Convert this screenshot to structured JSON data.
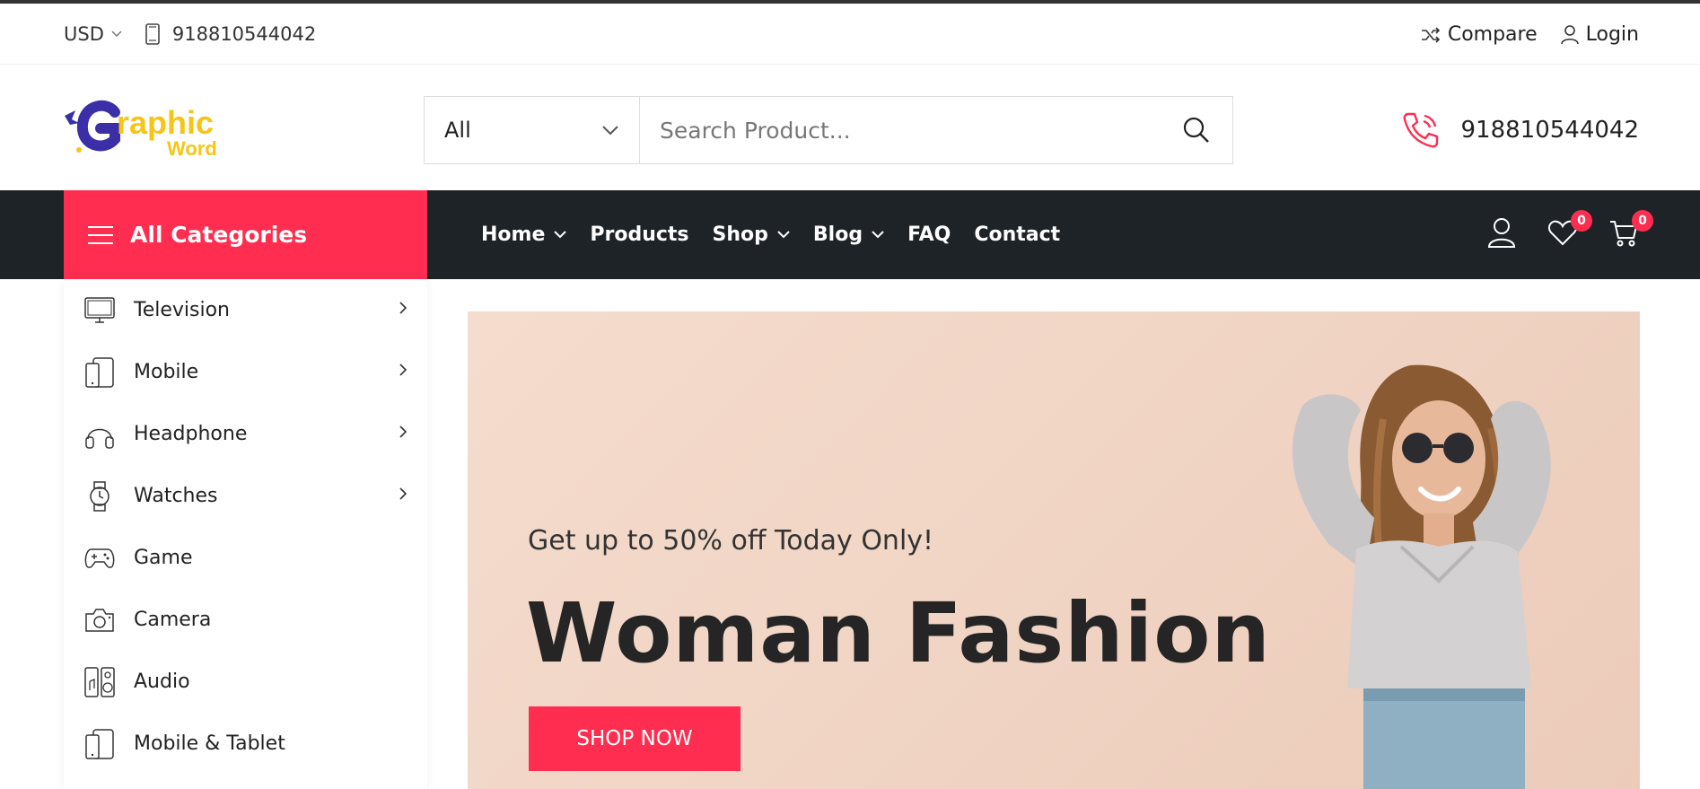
{
  "topbar": {
    "currency": "USD",
    "phone": "918810544042",
    "compare_label": "Compare",
    "login_label": "Login"
  },
  "header": {
    "logo_text_main": "raphic",
    "logo_text_sub": "Word",
    "search_category": "All",
    "search_placeholder": "Search Product...",
    "hotline": "918810544042"
  },
  "navbar": {
    "all_categories_label": "All Categories",
    "menu": [
      {
        "label": "Home"
      },
      {
        "label": "Products"
      },
      {
        "label": "Shop"
      },
      {
        "label": "Blog"
      },
      {
        "label": "FAQ"
      },
      {
        "label": "Contact"
      }
    ],
    "wishlist_count": "0",
    "cart_count": "0"
  },
  "sidebar": {
    "items": [
      {
        "label": "Television",
        "icon": "tv-icon"
      },
      {
        "label": "Mobile",
        "icon": "mobile-icon"
      },
      {
        "label": "Headphone",
        "icon": "headphone-icon"
      },
      {
        "label": "Watches",
        "icon": "watch-icon"
      },
      {
        "label": "Game",
        "icon": "gamepad-icon"
      },
      {
        "label": "Camera",
        "icon": "camera-icon"
      },
      {
        "label": "Audio",
        "icon": "speaker-icon"
      },
      {
        "label": "Mobile & Tablet",
        "icon": "tablet-icon"
      }
    ]
  },
  "hero": {
    "subtitle": "Get up to 50% off Today Only!",
    "title": "Woman Fashion",
    "button_label": "SHOP NOW"
  },
  "colors": {
    "accent": "#ff2d4f",
    "nav_bg": "#1e2327",
    "hero_bg": "#f3d7c8",
    "logo_purple": "#3b2fa8",
    "logo_yellow": "#f5c518"
  }
}
